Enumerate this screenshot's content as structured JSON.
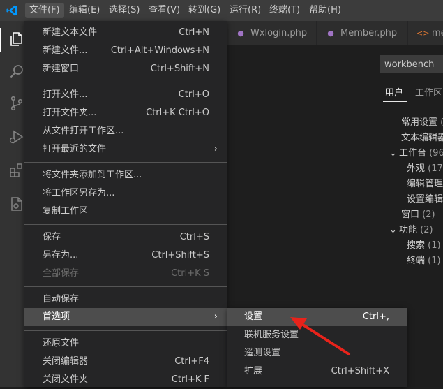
{
  "menubar": {
    "items": [
      "文件(F)",
      "编辑(E)",
      "选择(S)",
      "查看(V)",
      "转到(G)",
      "运行(R)",
      "终端(T)",
      "帮助(H)"
    ]
  },
  "tabs": [
    {
      "label": "Wxlogin.php",
      "icon": "php-icon"
    },
    {
      "label": "Member.php",
      "icon": "php-icon"
    },
    {
      "label": "me",
      "icon": "code-icon"
    }
  ],
  "settings": {
    "search_value": "workbench",
    "tabs": [
      "用户",
      "工作区"
    ],
    "toc": [
      {
        "label": "常用设置",
        "count": "("
      },
      {
        "label": "文本编辑器",
        "count": ""
      },
      {
        "label": "工作台",
        "count": "(96"
      },
      {
        "label": "外观",
        "count": "(17)"
      },
      {
        "label": "编辑管理",
        "count": ""
      },
      {
        "label": "设置编辑",
        "count": ""
      },
      {
        "label": "窗口",
        "count": "(2)"
      },
      {
        "label": "功能",
        "count": "(2)"
      },
      {
        "label": "搜索",
        "count": "(1)"
      },
      {
        "label": "终端",
        "count": "(1)"
      }
    ]
  },
  "file_menu": {
    "items": [
      {
        "label": "新建文本文件",
        "shortcut": "Ctrl+N"
      },
      {
        "label": "新建文件...",
        "shortcut": "Ctrl+Alt+Windows+N"
      },
      {
        "label": "新建窗口",
        "shortcut": "Ctrl+Shift+N"
      },
      {
        "label": "打开文件...",
        "shortcut": "Ctrl+O"
      },
      {
        "label": "打开文件夹...",
        "shortcut": "Ctrl+K Ctrl+O"
      },
      {
        "label": "从文件打开工作区...",
        "shortcut": ""
      },
      {
        "label": "打开最近的文件",
        "shortcut": "",
        "submenu": true
      },
      {
        "label": "将文件夹添加到工作区...",
        "shortcut": ""
      },
      {
        "label": "将工作区另存为...",
        "shortcut": ""
      },
      {
        "label": "复制工作区",
        "shortcut": ""
      },
      {
        "label": "保存",
        "shortcut": "Ctrl+S"
      },
      {
        "label": "另存为...",
        "shortcut": "Ctrl+Shift+S"
      },
      {
        "label": "全部保存",
        "shortcut": "Ctrl+K S",
        "disabled": true
      },
      {
        "label": "自动保存",
        "shortcut": ""
      },
      {
        "label": "首选项",
        "shortcut": "",
        "submenu": true,
        "highlighted": true
      },
      {
        "label": "还原文件",
        "shortcut": ""
      },
      {
        "label": "关闭编辑器",
        "shortcut": "Ctrl+F4"
      },
      {
        "label": "关闭文件夹",
        "shortcut": "Ctrl+K F"
      }
    ]
  },
  "prefs_menu": {
    "items": [
      {
        "label": "设置",
        "shortcut": "Ctrl+,",
        "highlighted": true
      },
      {
        "label": "联机服务设置",
        "shortcut": ""
      },
      {
        "label": "遥测设置",
        "shortcut": ""
      },
      {
        "label": "扩展",
        "shortcut": "Ctrl+Shift+X"
      }
    ]
  },
  "arrow_icon": "›",
  "colors": {
    "accent_blue": "#007acc",
    "annotation_red": "#e8231b",
    "menu_bg": "#252526",
    "highlight_bg": "#4d4d4d"
  }
}
